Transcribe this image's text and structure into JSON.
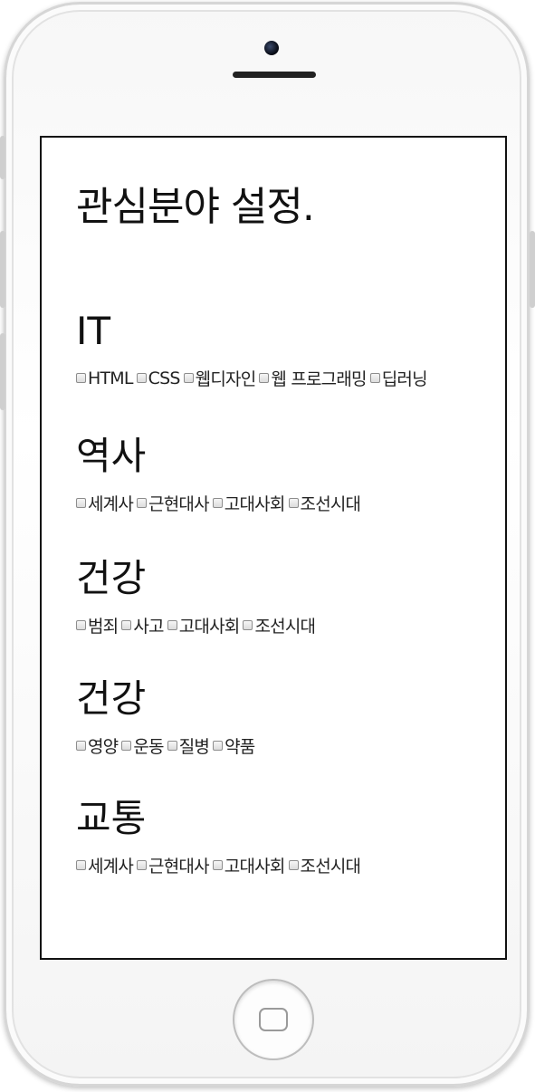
{
  "page": {
    "title": "관심분야 설정."
  },
  "sections": [
    {
      "heading": "IT",
      "options": [
        "HTML",
        "CSS",
        "웹디자인",
        "웹 프로그래밍",
        "딥러닝"
      ]
    },
    {
      "heading": "역사",
      "options": [
        "세계사",
        "근현대사",
        "고대사회",
        "조선시대"
      ]
    },
    {
      "heading": "건강",
      "options": [
        "범죄",
        "사고",
        "고대사회",
        "조선시대"
      ]
    },
    {
      "heading": "건강",
      "options": [
        "영양",
        "운동",
        "질병",
        "약품"
      ]
    },
    {
      "heading": "교통",
      "options": [
        "세계사",
        "근현대사",
        "고대사회",
        "조선시대"
      ]
    }
  ],
  "device": {
    "icons": [
      "camera-icon",
      "speaker-icon",
      "home-button-icon"
    ]
  }
}
